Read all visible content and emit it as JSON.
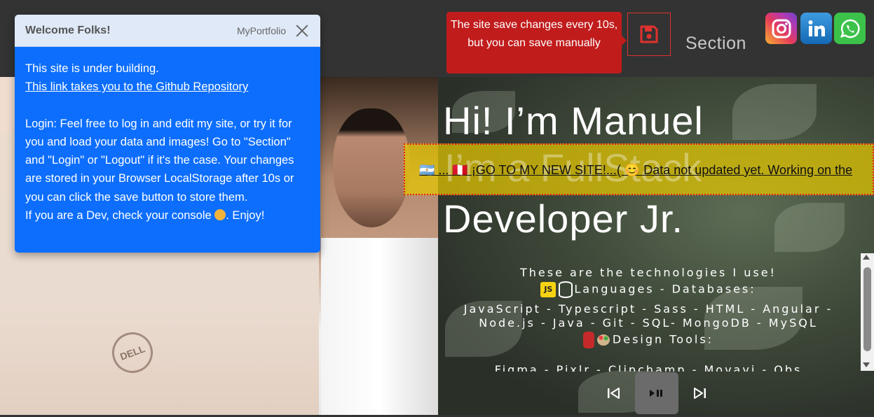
{
  "header": {
    "save_tooltip": "The site save changes every 10s, but you can save manually",
    "section_label": "Section",
    "social": [
      "instagram-icon",
      "linkedin-icon",
      "whatsapp-icon"
    ]
  },
  "hero": {
    "line1": "Hi! I’m Manuel",
    "line2": "I’m a FullStack",
    "line3": "Developer Jr."
  },
  "ticker": {
    "text": "🇦🇷 ... 🇵🇪 ¡GO TO MY NEW SITE!...( 😊 Data not updated yet. Working on the"
  },
  "tech": {
    "intro": "These are the technologies I use!",
    "languages_heading": "Languages - Databases:",
    "languages_list": "JavaScript - Typescript - Sass - HTML - Angular - Node.js - Java - Git - SQL- MongoDB - MySQL",
    "design_heading": "Design Tools:",
    "design_list_cut": "Figma - Pixlr - Clipchamp - Movavi - Obs"
  },
  "toast": {
    "title": "Welcome Folks!",
    "brand": "MyPortfolio",
    "line1": "This site is under building.",
    "link": "This link takes you to the Github Repository",
    "login_text": "Login: Feel free to log in and edit my site, or try it for you and load your data and images! Go to \"Section\" and \"Login\" or \"Logout\" if it's the case. Your changes are stored in your Browser LocalStorage after 10s or you can click the save button to store them.",
    "dev_text": "If you are a Dev, check your console",
    "enjoy": ". Enjoy!"
  },
  "photo": {
    "laptop_logo": "DELL"
  },
  "colors": {
    "toast_body": "#0d6efd",
    "tooltip": "#c11c1c",
    "ticker": "#e6c800",
    "background": "#333333"
  }
}
